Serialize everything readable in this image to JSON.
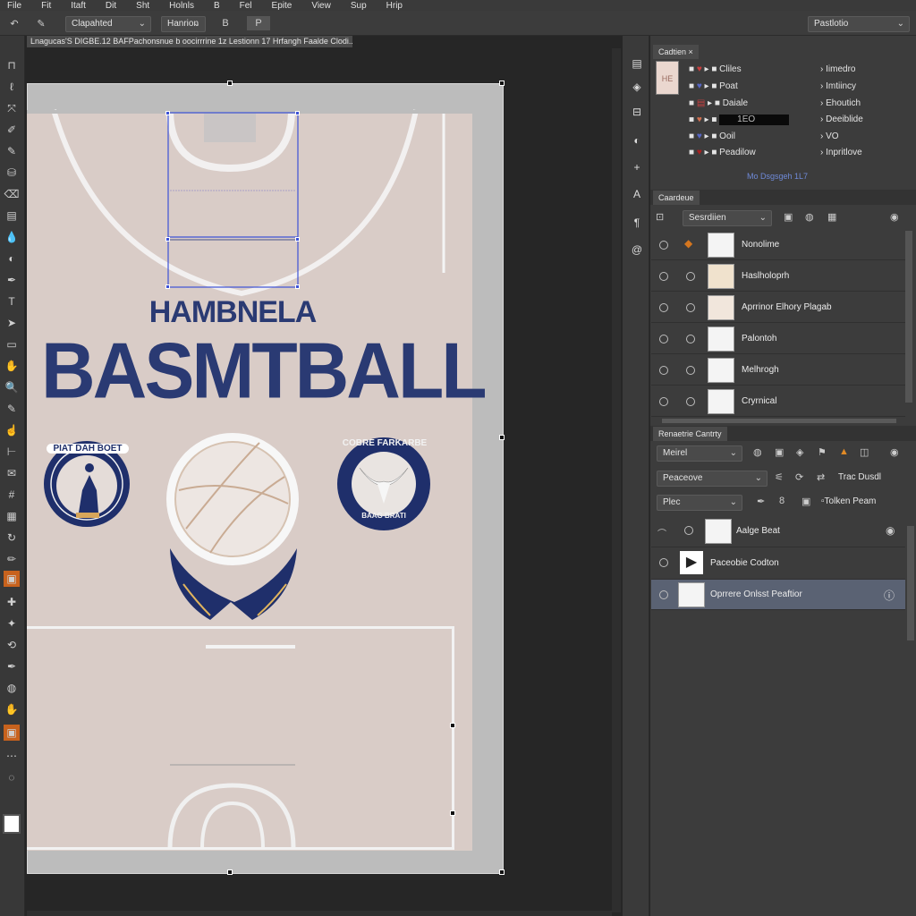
{
  "menu": [
    "File",
    "Fit",
    "Itaft",
    "Dit",
    "Sht",
    "Holnls",
    "B",
    "Fel",
    "Epite",
    "View",
    "Sup",
    "Hrip"
  ],
  "options_bar": {
    "dropdown1": "Clapahted",
    "dropdown2": "Hanrion",
    "right_dropdown": "Pastlotio"
  },
  "document_tab": "Lnagucas'S DIGBE.12 BAFPachonsnue b oocirrrine 1z Lestionn 17 Hrfangh  Faalde Clodi...",
  "artboard": {
    "subtitle": "HAMBNELA",
    "title": "BASMTBALL",
    "badge_left_text": "PIAT DAH BOET",
    "badge_right_text": "COBRE FARKARBE",
    "badge_right_sub": "BAAG BRATI"
  },
  "colors_panel": {
    "tab": "Cadtien",
    "swatch_names": [
      "Cliles",
      "Poat",
      "Daiale",
      "",
      "Ooil",
      "Peadilow"
    ],
    "swatch_values": [
      "Iimedro",
      "Imtiincy",
      "Ehoutich",
      "Deeiblide",
      "VO",
      "Inpritlove"
    ],
    "hex_value": "1EO",
    "footer_link": "Mo Dsgsgeh 1L7"
  },
  "layers_panel": {
    "tab": "Caardeue",
    "search_dropdown": "Sesrdiien",
    "layers": [
      "Nonolime",
      "Haslholoprh",
      "Aprrinor Elhory Plagab",
      "Palontoh",
      "Melhrogh",
      "Cryrnical"
    ]
  },
  "properties_panel": {
    "tab": "Renaetrie Cantrty",
    "dropdown1": "Meirel",
    "dropdown2": "Peaceove",
    "dropdown3": "Plec",
    "label_trac": "Trac Dusdl",
    "label_tolken": "Tolken Peam",
    "items": [
      "Aalge Beat",
      "Paceobie Codton",
      "Oprrere Onlsst Peaftior"
    ]
  }
}
